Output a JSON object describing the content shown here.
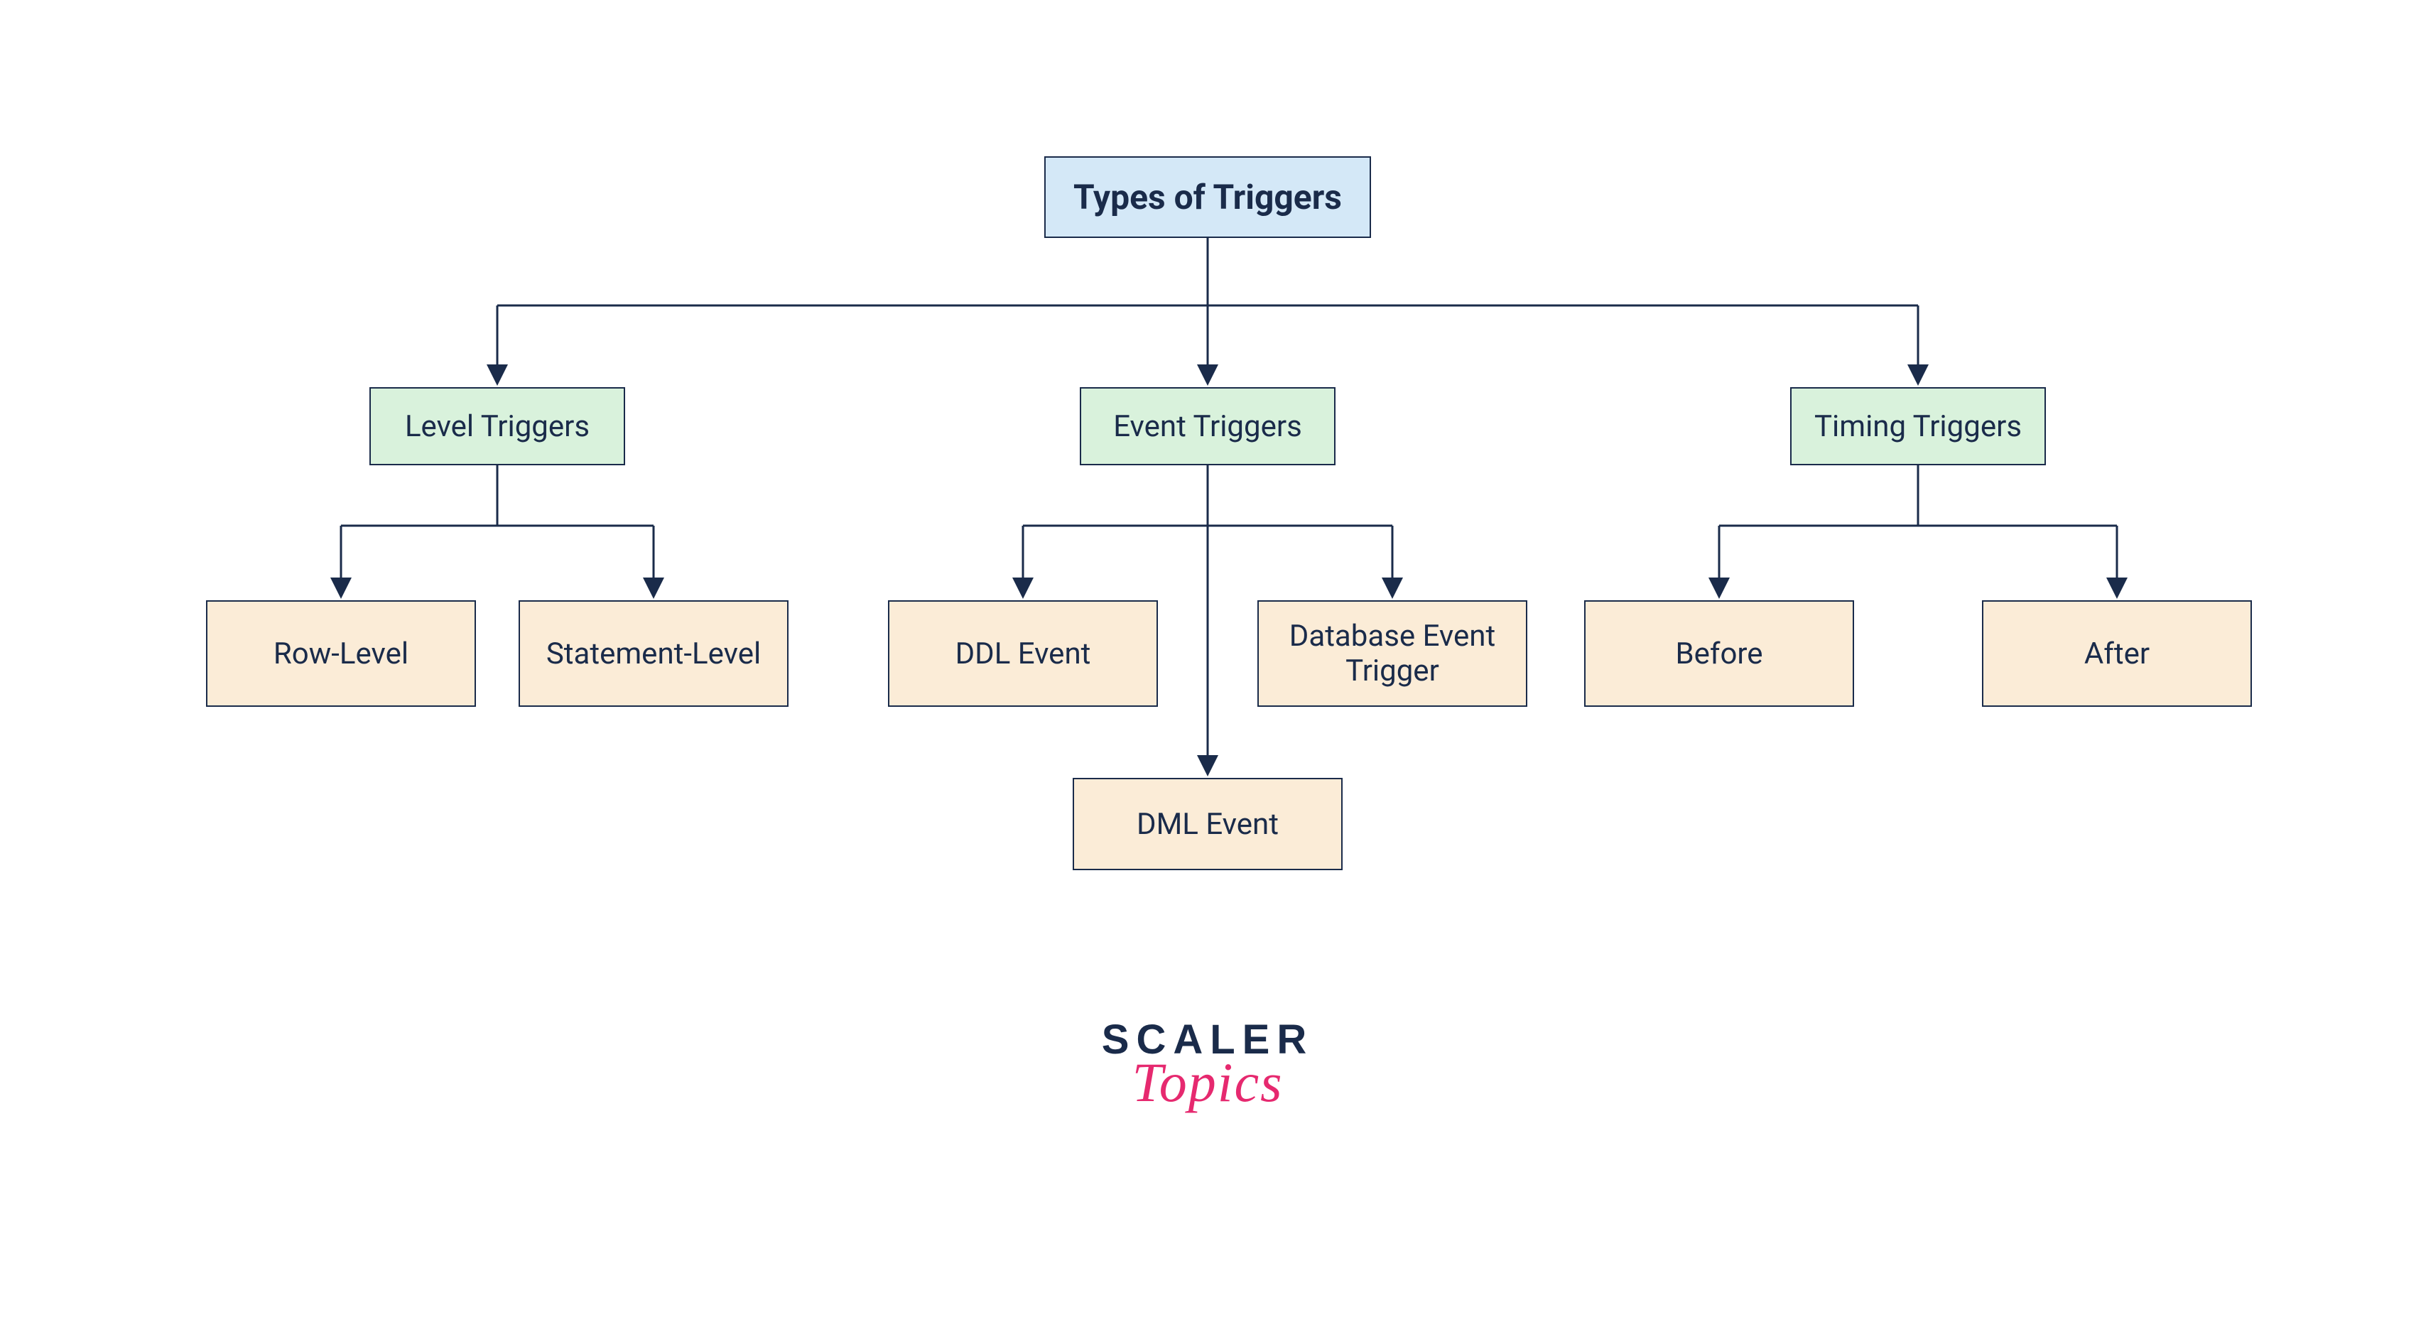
{
  "diagram": {
    "root": {
      "label": "Types of Triggers"
    },
    "categories": {
      "level": {
        "label": "Level Triggers"
      },
      "event": {
        "label": "Event Triggers"
      },
      "timing": {
        "label": "Timing Triggers"
      }
    },
    "leaves": {
      "row_level": {
        "label": "Row-Level"
      },
      "statement_level": {
        "label": "Statement-Level"
      },
      "ddl_event": {
        "label": "DDL Event"
      },
      "db_event": {
        "label": "Database Event Trigger"
      },
      "dml_event": {
        "label": "DML Event"
      },
      "before": {
        "label": "Before"
      },
      "after": {
        "label": "After"
      }
    }
  },
  "logo": {
    "primary": "SCALER",
    "secondary": "Topics"
  },
  "colors": {
    "root_bg": "#d4e8f7",
    "cat_bg": "#d9f2dc",
    "leaf_bg": "#fbecd7",
    "border": "#1a2b4a",
    "logo_primary": "#1a2b4a",
    "logo_secondary": "#e6296f"
  }
}
